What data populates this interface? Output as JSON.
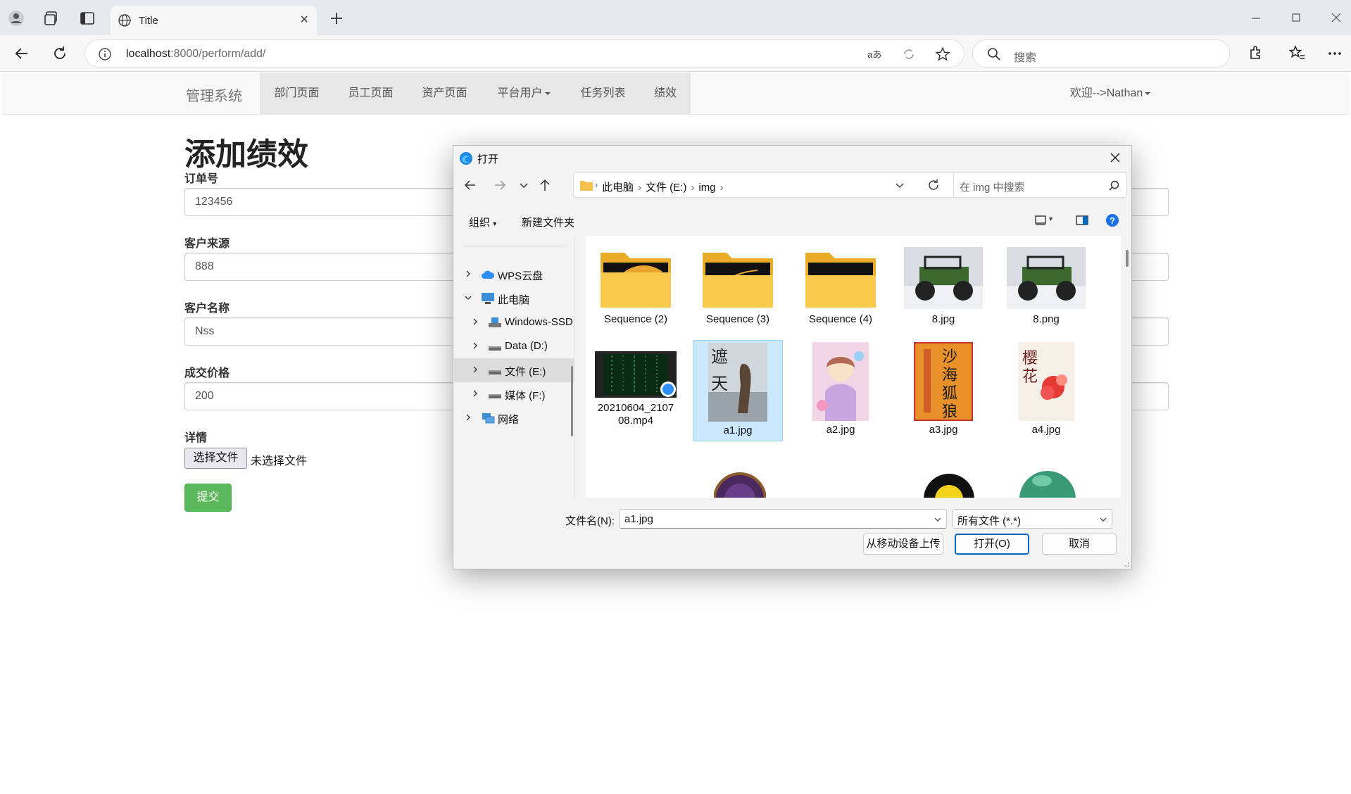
{
  "browser": {
    "tab_title": "Title",
    "url_host": "localhost",
    "url_rest": ":8000/perform/add/",
    "search_placeholder": "搜索"
  },
  "navbar": {
    "brand": "管理系统",
    "items": [
      {
        "label": "部门页面"
      },
      {
        "label": "员工页面"
      },
      {
        "label": "资产页面"
      },
      {
        "label": "平台用户"
      },
      {
        "label": "任务列表"
      },
      {
        "label": "绩效"
      }
    ],
    "user": "欢迎-->Nathan"
  },
  "form": {
    "title": "添加绩效",
    "fields": [
      {
        "label": "订单号",
        "value": "123456"
      },
      {
        "label": "客户来源",
        "value": "888"
      },
      {
        "label": "客户名称",
        "value": "Nss"
      },
      {
        "label": "成交价格",
        "value": "200"
      }
    ],
    "detail_label": "详情",
    "file_button": "选择文件",
    "file_status": "未选择文件",
    "submit": "提交"
  },
  "dialog": {
    "title": "打开",
    "breadcrumb": [
      "此电脑",
      "文件 (E:)",
      "img"
    ],
    "search_placeholder": "在 img 中搜索",
    "organize": "组织",
    "new_folder": "新建文件夹",
    "sidebar": [
      {
        "label": "WPS云盘"
      },
      {
        "label": "此电脑"
      },
      {
        "label": "Windows-SSD"
      },
      {
        "label": "Data (D:)"
      },
      {
        "label": "文件 (E:)"
      },
      {
        "label": "媒体 (F:)"
      },
      {
        "label": "网络"
      }
    ],
    "files": [
      {
        "name": "Sequence (2)"
      },
      {
        "name": "Sequence (3)"
      },
      {
        "name": "Sequence (4)"
      },
      {
        "name": "8.jpg"
      },
      {
        "name": "8.png"
      },
      {
        "name": "20210604_210708.mp4"
      },
      {
        "name": "a1.jpg"
      },
      {
        "name": "a2.jpg"
      },
      {
        "name": "a3.jpg"
      },
      {
        "name": "a4.jpg"
      }
    ],
    "filename_label": "文件名(N):",
    "filename_value": "a1.jpg",
    "filetype_value": "所有文件 (*.*)",
    "upload_button": "从移动设备上传",
    "open_button": "打开(O)",
    "cancel_button": "取消"
  }
}
